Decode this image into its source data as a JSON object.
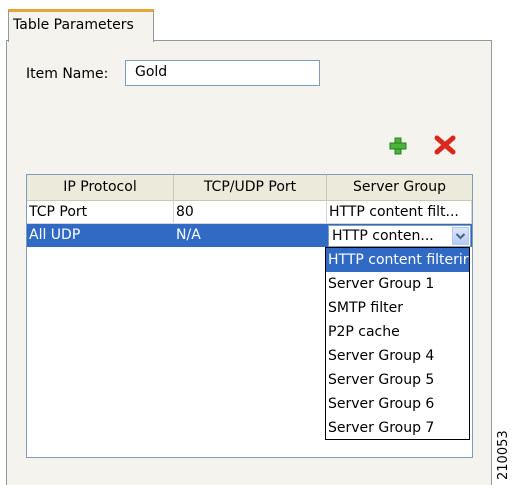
{
  "tab": {
    "label": "Table Parameters"
  },
  "item": {
    "label": "Item Name:",
    "value": "Gold"
  },
  "toolbar": {
    "add_icon": "plus-icon",
    "delete_icon": "red-x-icon"
  },
  "table": {
    "columns": [
      "IP Protocol",
      "TCP/UDP Port",
      "Server Group"
    ],
    "rows": [
      [
        "TCP Port",
        "80",
        "HTTP content filt..."
      ],
      [
        "All UDP",
        "N/A",
        "HTTP conten..."
      ]
    ],
    "selected_row": 1
  },
  "dropdown": {
    "options": [
      "HTTP content filterir",
      "Server Group 1",
      "SMTP filter",
      "P2P cache",
      "Server Group 4",
      "Server Group 5",
      "Server Group 6",
      "Server Group 7"
    ],
    "selected_index": 0
  },
  "watermark": "210053",
  "colors": {
    "selection": "#316ac5",
    "tab_accent": "#e8a33a",
    "delete": "#d9281c",
    "add": "#3aa02a"
  }
}
